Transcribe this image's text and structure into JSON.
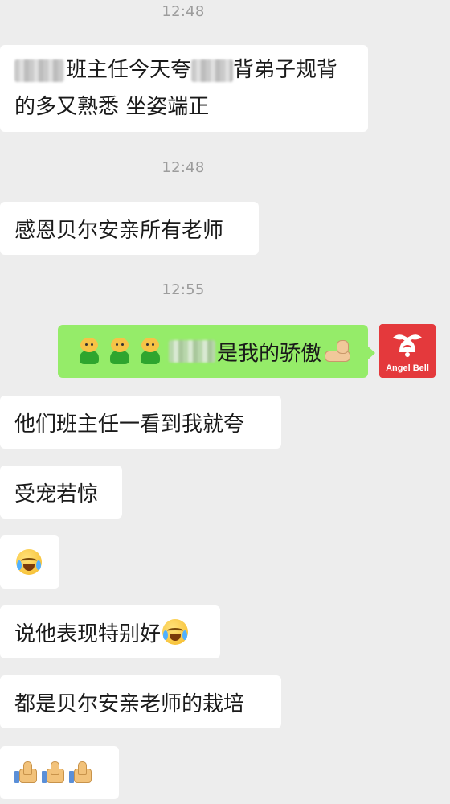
{
  "chat": {
    "timestamps": [
      "12:48",
      "12:48",
      "12:55"
    ],
    "messages": [
      {
        "sender": "other",
        "line1": "班主任今天夸",
        "line1b": "背弟子规背",
        "line2": "的多又熟悉  坐姿端正"
      },
      {
        "sender": "other",
        "text": "感恩贝尔安亲所有老师"
      },
      {
        "sender": "self",
        "text": "是我的骄傲",
        "leading_emojis": [
          "frog-emoji",
          "frog-emoji",
          "frog-emoji"
        ],
        "trailing_emoji": "flexed-biceps-emoji"
      },
      {
        "sender": "other",
        "text": "他们班主任一看到我就夸"
      },
      {
        "sender": "other",
        "text": "受宠若惊"
      },
      {
        "sender": "other",
        "emoji": "face-with-tears-of-joy-emoji"
      },
      {
        "sender": "other",
        "text": "说他表现特别好",
        "trailing_emoji": "face-with-tears-of-joy-emoji"
      },
      {
        "sender": "other",
        "text": "都是贝尔安亲老师的栽培"
      },
      {
        "sender": "other",
        "emojis": [
          "thumbs-up-emoji",
          "thumbs-up-emoji",
          "thumbs-up-emoji"
        ]
      }
    ]
  },
  "self_avatar": {
    "label": "Angel Bell",
    "color": "#e4393c"
  },
  "colors": {
    "background": "#ededed",
    "received_bubble": "#ffffff",
    "sent_bubble": "#95ec69",
    "timestamp_text": "#9c9c9c"
  }
}
